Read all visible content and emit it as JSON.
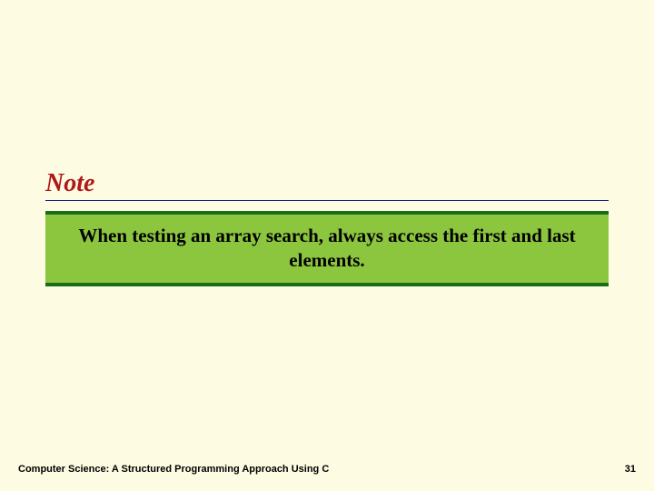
{
  "note_label": "Note",
  "callout_text": "When testing an array search, always access the first and last elements.",
  "footer": {
    "left": "Computer Science: A Structured Programming Approach Using C",
    "right": "31"
  }
}
